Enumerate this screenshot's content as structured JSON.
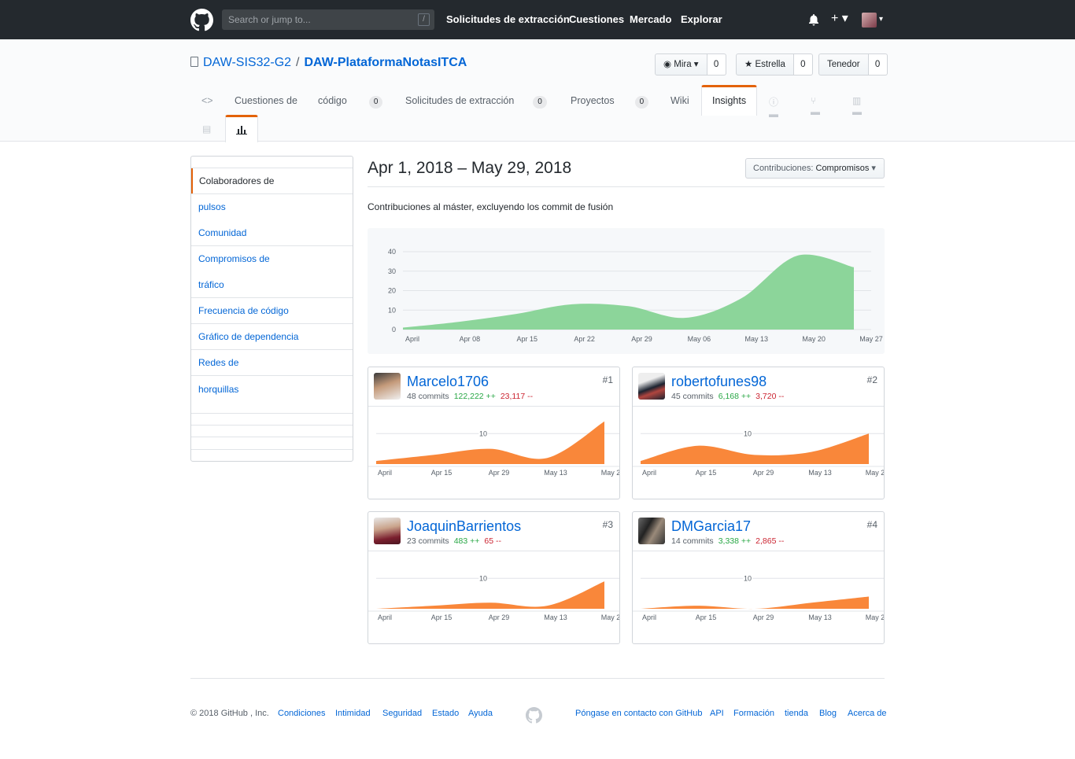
{
  "header": {
    "search_placeholder": "Search or jump to...",
    "search_shortcut": "/",
    "nav": [
      "Solicitudes de extracción",
      "Cuestiones",
      "Mercado",
      "Explorar"
    ],
    "plus": "+ ▾",
    "avatar_caret": "▾",
    "bell": "🔔"
  },
  "repo": {
    "owner": "DAW-SIS32-G2",
    "separator": "/",
    "name": "DAW-PlataformaNotasITCA",
    "watch_label": "Mira ▾",
    "watch_count": "0",
    "star_label": "Estrella",
    "star_count": "0",
    "fork_label": "Tenedor",
    "fork_count": "0",
    "tabs": {
      "code_icon": "<>",
      "issues": "Cuestiones de",
      "code": "código",
      "code_count": "0",
      "pulls": "Solicitudes de extracción",
      "pulls_count": "0",
      "projects": "Proyectos",
      "projects_count": "0",
      "wiki": "Wiki",
      "insights": "Insights"
    }
  },
  "sidebar": {
    "items": [
      "Colaboradores de",
      "pulsos",
      "Comunidad",
      "Compromisos de",
      "tráfico",
      "Frecuencia de código",
      "Gráfico de dependencia",
      "Redes de",
      "horquillas"
    ]
  },
  "main": {
    "date_range": "Apr 1, 2018 – May 29, 2018",
    "select_prefix": "Contribuciones:",
    "select_value": "Compromisos",
    "select_caret": "▾",
    "subtitle": "Contribuciones al máster, excluyendo los commit de fusión"
  },
  "chart_data": [
    {
      "type": "area",
      "x": [
        "April",
        "Apr 08",
        "Apr 15",
        "Apr 22",
        "Apr 29",
        "May 06",
        "May 13",
        "May 20",
        "May 27"
      ],
      "values": [
        1,
        4,
        8,
        13,
        12,
        6,
        16,
        38,
        32
      ],
      "ylim": [
        0,
        40
      ],
      "yticks": [
        "0",
        "10",
        "20",
        "30",
        "40"
      ],
      "color": "#8cd59a"
    },
    {
      "type": "area",
      "contributor": "Marcelo1706",
      "x": [
        "April",
        "Apr 15",
        "Apr 29",
        "May 13",
        "May 2"
      ],
      "values": [
        1,
        3,
        5,
        2,
        14
      ],
      "ylim": [
        0,
        16
      ],
      "ytick": "10",
      "color": "#f9873a"
    },
    {
      "type": "area",
      "contributor": "robertofunes98",
      "x": [
        "April",
        "Apr 15",
        "Apr 29",
        "May 13",
        "May 2"
      ],
      "values": [
        1,
        6,
        3,
        4,
        10
      ],
      "ylim": [
        0,
        16
      ],
      "ytick": "10",
      "color": "#f9873a"
    },
    {
      "type": "area",
      "contributor": "JoaquinBarrientos",
      "x": [
        "April",
        "Apr 15",
        "Apr 29",
        "May 13",
        "May 2"
      ],
      "values": [
        0,
        1,
        2,
        1,
        9
      ],
      "ylim": [
        0,
        16
      ],
      "ytick": "10",
      "color": "#f9873a"
    },
    {
      "type": "area",
      "contributor": "DMGarcia17",
      "x": [
        "April",
        "Apr 15",
        "Apr 29",
        "May 13",
        "May 2"
      ],
      "values": [
        0,
        1,
        0,
        2,
        4
      ],
      "ylim": [
        0,
        16
      ],
      "ytick": "10",
      "color": "#f9873a"
    }
  ],
  "contributors": [
    {
      "rank": "#1",
      "name": "Marcelo1706",
      "commits": "48 commits",
      "additions": "122,222 ++",
      "deletions": "23,117 --"
    },
    {
      "rank": "#2",
      "name": "robertofunes98",
      "commits": "45 commits",
      "additions": "6,168 ++",
      "deletions": "3,720 --"
    },
    {
      "rank": "#3",
      "name": "JoaquinBarrientos",
      "commits": "23 commits",
      "additions": "483 ++",
      "deletions": "65 --"
    },
    {
      "rank": "#4",
      "name": "DMGarcia17",
      "commits": "14 commits",
      "additions": "3,338 ++",
      "deletions": "2,865 --"
    }
  ],
  "footer": {
    "copyright": "© 2018 GitHub , Inc.",
    "left_links": [
      "Condiciones",
      "Intimidad",
      "Seguridad",
      "Estado",
      "Ayuda"
    ],
    "right_links": [
      "Póngase en contacto con GitHub",
      "API",
      "Formación",
      "tienda",
      "Blog",
      "Acerca de"
    ]
  }
}
